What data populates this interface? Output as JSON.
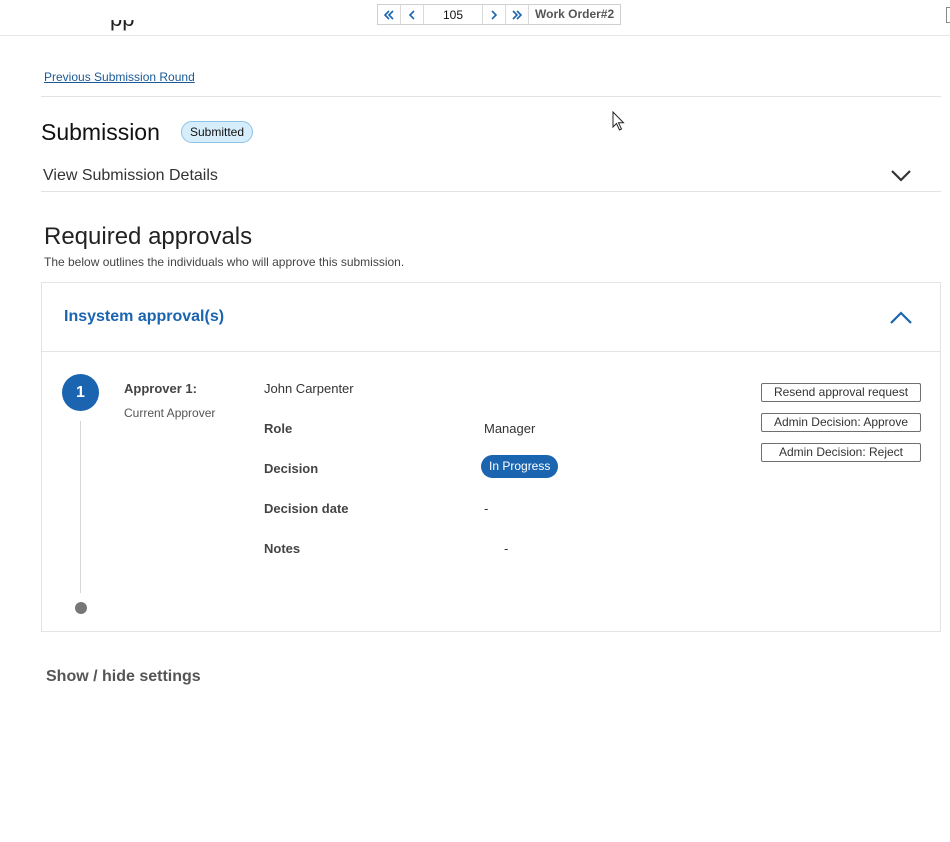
{
  "pager": {
    "page_value": "105",
    "record_label": "Work Order#2"
  },
  "header": {
    "previous_round_link": "Previous Submission Round"
  },
  "submission": {
    "title": "Submission",
    "status_badge": "Submitted",
    "view_details_label": "View Submission Details"
  },
  "approvals": {
    "title": "Required approvals",
    "description": "The below outlines the individuals who will approve this submission.",
    "panel_title": "Insystem approval(s)",
    "approvers": [
      {
        "step": "1",
        "label": "Approver 1:",
        "sublabel": "Current Approver",
        "name": "John Carpenter",
        "fields": {
          "role_label": "Role",
          "role_value": "Manager",
          "decision_label": "Decision",
          "decision_value": "In Progress",
          "decision_date_label": "Decision date",
          "decision_date_value": "-",
          "notes_label": "Notes",
          "notes_value": "-"
        },
        "actions": {
          "resend": "Resend approval request",
          "approve": "Admin Decision: Approve",
          "reject": "Admin Decision: Reject"
        }
      }
    ]
  },
  "settings": {
    "toggle_label": "Show / hide settings"
  },
  "colors": {
    "accent": "#1a64b0",
    "badge_bg": "#d6eefc",
    "badge_border": "#8cc3e6"
  },
  "icons": {
    "first": "double-chevron-left-icon",
    "prev": "chevron-left-icon",
    "next": "chevron-right-icon",
    "last": "double-chevron-right-icon",
    "expand": "chevron-down-icon",
    "collapse": "chevron-up-icon"
  }
}
